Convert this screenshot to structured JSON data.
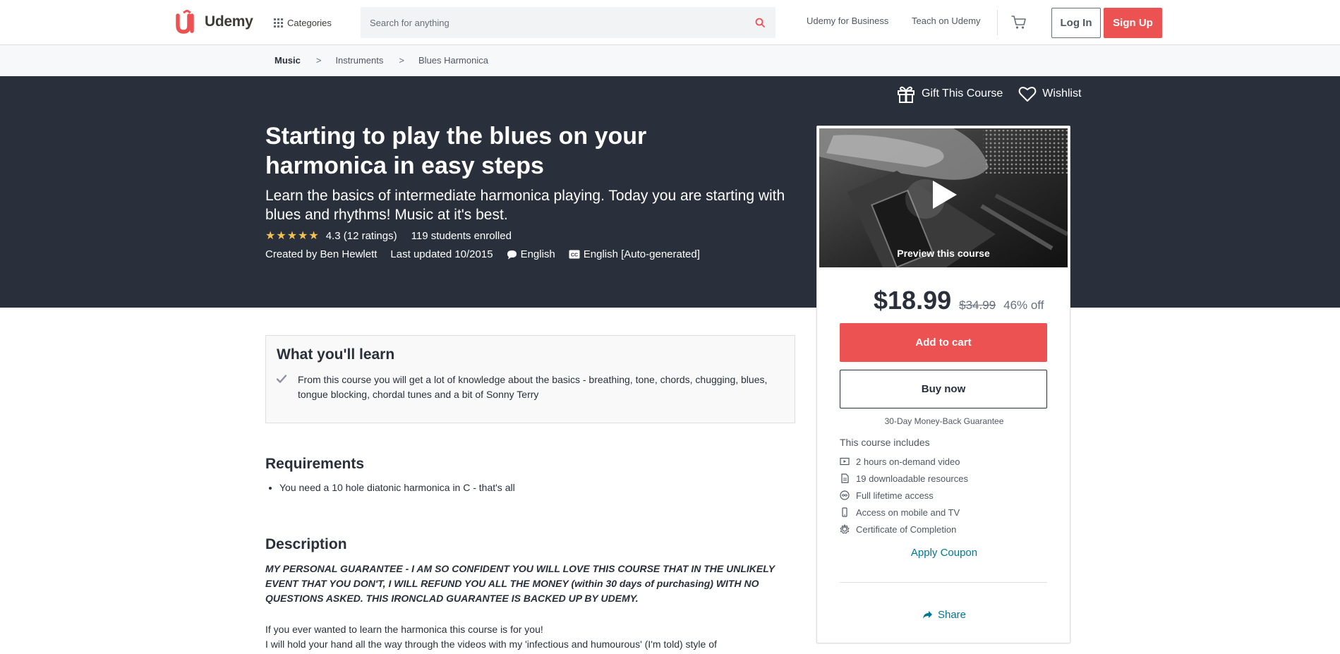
{
  "header": {
    "brand": "Udemy",
    "categories_label": "Categories",
    "search_placeholder": "Search for anything",
    "business_link": "Udemy for Business",
    "teach_link": "Teach on Udemy",
    "login_label": "Log In",
    "signup_label": "Sign Up"
  },
  "breadcrumb": [
    "Music",
    "Instruments",
    "Blues Harmonica"
  ],
  "breadcrumb_separator": ">",
  "course": {
    "gift_label": "Gift This Course",
    "wishlist_label": "Wishlist",
    "title": "Starting to play the blues on your harmonica in easy steps",
    "subtitle": "Learn the basics of intermediate harmonica playing. Today you are starting with blues and rhythms! Music at it's best.",
    "rating": "4.3",
    "rating_stars": 4.3,
    "ratings_count": "(12 ratings)",
    "students": "119 students enrolled",
    "created_by": "Created by Ben Hewlett",
    "last_updated": "Last updated 10/2015",
    "language": "English",
    "captions": "English [Auto-generated]"
  },
  "sidebar": {
    "preview_label": "Preview this course",
    "price": "$18.99",
    "original_price": "$34.99",
    "discount": "46% off",
    "add_to_cart": "Add to cart",
    "buy_now": "Buy now",
    "guarantee": "30-Day Money-Back Guarantee",
    "includes_title": "This course includes",
    "includes": [
      {
        "icon": "video-icon",
        "label": "2 hours on-demand video"
      },
      {
        "icon": "file-icon",
        "label": "19 downloadable resources"
      },
      {
        "icon": "infinity-icon",
        "label": "Full lifetime access"
      },
      {
        "icon": "mobile-icon",
        "label": "Access on mobile and TV"
      },
      {
        "icon": "certificate-icon",
        "label": "Certificate of Completion"
      }
    ],
    "apply_coupon": "Apply Coupon",
    "share": "Share"
  },
  "learn": {
    "title": "What you'll learn",
    "items": [
      "From this course you will get a lot of knowledge about the basics - breathing, tone, chords, chugging, blues, tongue blocking, chordal tunes and a bit of Sonny Terry"
    ]
  },
  "requirements": {
    "title": "Requirements",
    "items": [
      "You need a 10 hole diatonic harmonica in C - that's all"
    ]
  },
  "description": {
    "title": "Description",
    "guarantee": "MY PERSONAL GUARANTEE - I AM SO CONFIDENT YOU WILL LOVE THIS COURSE THAT IN THE UNLIKELY EVENT THAT YOU DON'T, I WILL REFUND YOU ALL THE MONEY (within 30 days of purchasing) WITH NO QUESTIONS ASKED. THIS IRONCLAD GUARANTEE IS BACKED UP BY UDEMY.",
    "paragraph1": "If you ever wanted to learn the harmonica this course is for you!",
    "paragraph2": "I will hold your hand all the way through the videos with my 'infectious and humourous' (I'm told) style of"
  },
  "colors": {
    "brand": "#ec5252",
    "hero_bg": "#29303b",
    "star": "#f4c150",
    "link": "#007791"
  }
}
